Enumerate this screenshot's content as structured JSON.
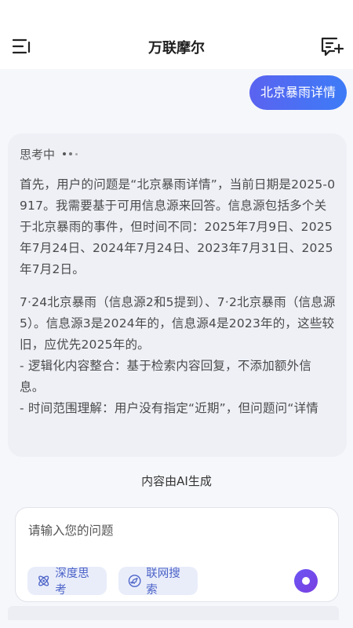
{
  "header": {
    "title": "万联摩尔"
  },
  "user_message": "北京暴雨详情",
  "thinking": {
    "label": "思考中",
    "paragraphs": [
      "首先，用户的问题是“北京暴雨详情”，当前日期是2025-0917。我需要基于可用信息源来回答。信息源包括多个关于北京暴雨的事件，但时间不同：2025年7月9日、2025年7月24日、2024年7月24日、2023年7月31日、2025年7月2日。",
      "7·24北京暴雨（信息源2和5提到）、7·2北京暴雨（信息源5）。信息源3是2024年的，信息源4是2023年的，这些较旧，应优先2025年的。\n- 逻辑化内容整合：基于检索内容回复，不添加额外信息。\n- 时间范围理解：用户没有指定“近期”，但问题问“详情"
    ]
  },
  "footnote": "内容由AI生成",
  "input": {
    "placeholder": "请输入您的问题",
    "deep_think_label": "深度思考",
    "web_search_label": "联网搜索"
  },
  "icons": {
    "menu": "menu-collapse-icon",
    "new_chat": "new-chat-icon",
    "deep_think": "atom-icon",
    "web_search": "compass-icon",
    "send": "send-icon"
  },
  "colors": {
    "accent": "#4c63c8",
    "bubble_start": "#5a63f0",
    "bubble_end": "#3d7bf7",
    "send": "#6b55f4"
  }
}
